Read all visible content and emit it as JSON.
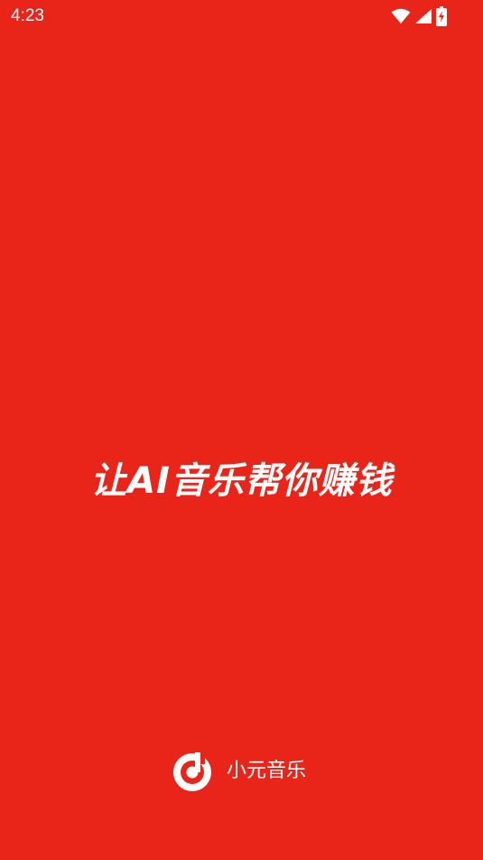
{
  "status_bar": {
    "time": "4:23",
    "icons": [
      "wifi-icon",
      "cellular-signal-icon",
      "battery-charging-icon"
    ]
  },
  "splash": {
    "slogan": "让AI音乐帮你赚钱",
    "brand_name": "小元音乐",
    "logo_icon": "music-note-disc-icon"
  },
  "colors": {
    "background": "#E9251A",
    "foreground": "#FFFFFF"
  }
}
